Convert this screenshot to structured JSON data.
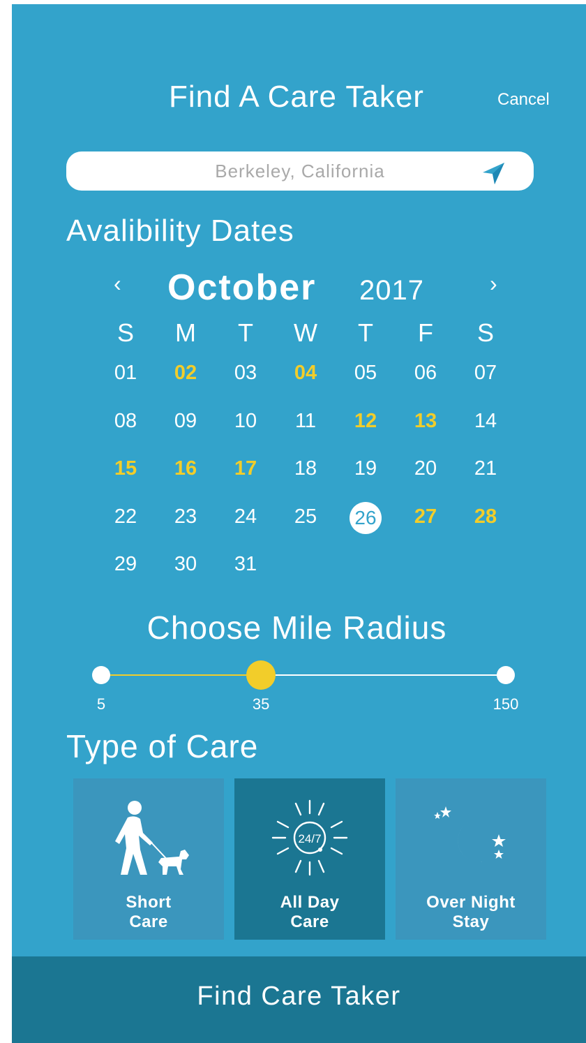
{
  "header": {
    "title": "Find A Care Taker",
    "cancel_label": "Cancel"
  },
  "search": {
    "placeholder": "Berkeley, California",
    "value": "",
    "action_icon": "location-arrow-icon"
  },
  "availability": {
    "heading": "Avalibility Dates",
    "calendar": {
      "month": "October",
      "year": "2017",
      "prev_icon": "chevron-left-icon",
      "next_icon": "chevron-right-icon",
      "weekdays": [
        "S",
        "M",
        "T",
        "W",
        "T",
        "F",
        "S"
      ],
      "weeks": [
        [
          "01",
          "02",
          "03",
          "04",
          "05",
          "06",
          "07"
        ],
        [
          "08",
          "09",
          "10",
          "11",
          "12",
          "13",
          "14"
        ],
        [
          "15",
          "16",
          "17",
          "18",
          "19",
          "20",
          "21"
        ],
        [
          "22",
          "23",
          "24",
          "25",
          "26",
          "27",
          "28"
        ],
        [
          "29",
          "30",
          "31",
          "",
          "",
          "",
          ""
        ]
      ],
      "highlighted_days": [
        "02",
        "04",
        "12",
        "13",
        "15",
        "16",
        "17",
        "27",
        "28"
      ],
      "selected_day": "26",
      "highlight_color": "#f2cd2a"
    }
  },
  "radius": {
    "heading": "Choose Mile Radius",
    "min": "5",
    "value": "35",
    "max": "150",
    "fill_fraction": 0.395,
    "accent_color": "#f2cd2a"
  },
  "care_type": {
    "heading": "Type of Care",
    "options": [
      {
        "label": "Short\nCare",
        "icon": "dog-walker-icon",
        "selected": false
      },
      {
        "label": "All Day\nCare",
        "icon": "sun-24-7-icon",
        "selected": true
      },
      {
        "label": "Over Night\nStay",
        "icon": "moon-stars-icon",
        "selected": false
      }
    ]
  },
  "footer": {
    "button_label": "Find Care Taker"
  },
  "colors": {
    "background": "#33a3cb",
    "dark_panel": "#1b7692",
    "card": "#3b96bd",
    "accent": "#f2cd2a"
  }
}
